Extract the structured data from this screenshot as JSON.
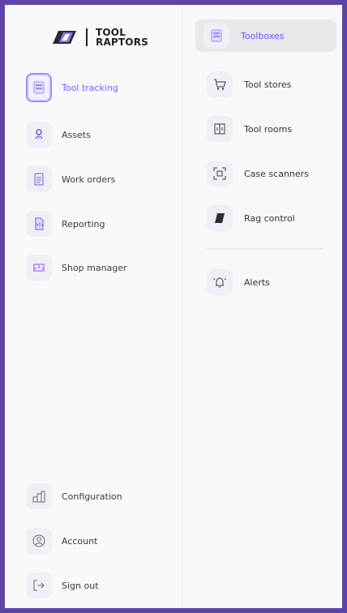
{
  "brand": {
    "name_line1": "TOOL",
    "name_line2": "RAPTORS"
  },
  "left_nav": {
    "items": [
      {
        "label": "Tool tracking",
        "icon": "tool-tracking-icon",
        "active": true
      },
      {
        "label": "Assets",
        "icon": "assets-icon"
      },
      {
        "label": "Work orders",
        "icon": "work-orders-icon"
      },
      {
        "label": "Reporting",
        "icon": "reporting-icon"
      },
      {
        "label": "Shop manager",
        "icon": "shop-manager-icon"
      }
    ],
    "bottom": [
      {
        "label": "Configuration",
        "icon": "configuration-icon"
      },
      {
        "label": "Account",
        "icon": "account-icon"
      },
      {
        "label": "Sign out",
        "icon": "sign-out-icon"
      }
    ]
  },
  "sub_nav": {
    "items": [
      {
        "label": "Toolboxes",
        "icon": "toolbox-icon",
        "active": true
      },
      {
        "label": "Tool stores",
        "icon": "cart-icon"
      },
      {
        "label": "Tool rooms",
        "icon": "tool-room-icon"
      },
      {
        "label": "Case scanners",
        "icon": "scanner-icon"
      },
      {
        "label": "Rag control",
        "icon": "rag-icon"
      }
    ],
    "alerts": {
      "label": "Alerts",
      "icon": "bell-icon"
    }
  },
  "colors": {
    "accent": "#7b5cff",
    "frame": "#5a45a6",
    "panel": "#f8f8fb",
    "active_bg": "#e8e8ec"
  }
}
